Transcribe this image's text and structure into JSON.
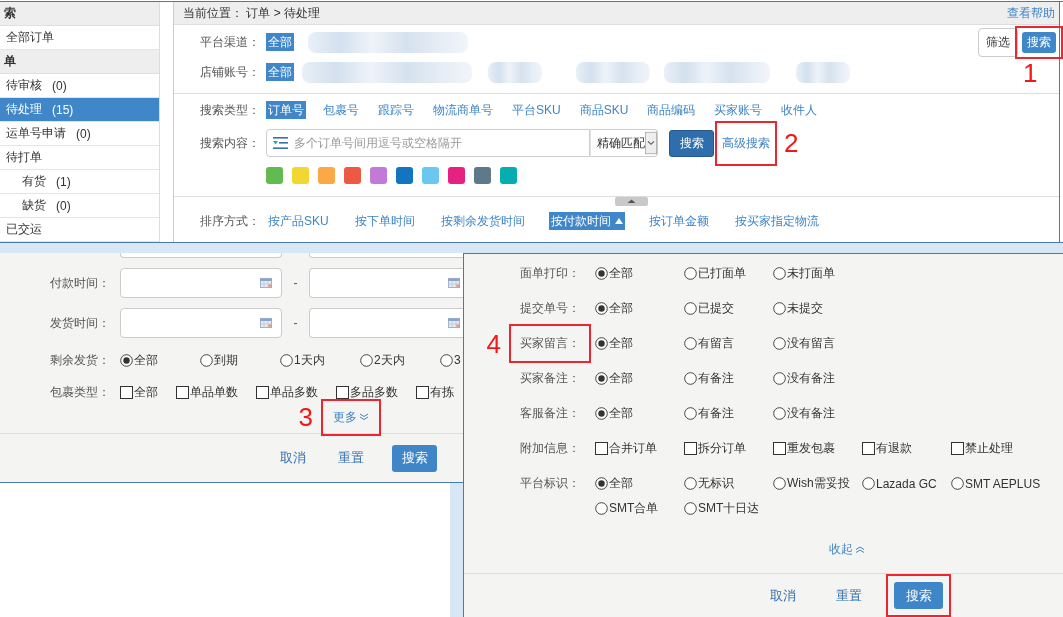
{
  "sidebar": {
    "groups": [
      {
        "title": "索",
        "items": [
          {
            "label": "全部订单",
            "selected": false
          }
        ]
      },
      {
        "title": "单",
        "items": [
          {
            "label": "待审核",
            "count": "(0)",
            "selected": false
          },
          {
            "label": "待处理",
            "count": "(15)",
            "selected": true
          },
          {
            "label": "运单号申请",
            "count": "(0)",
            "selected": false
          },
          {
            "label": "待打单",
            "selected": false,
            "children": [
              {
                "label": "有货",
                "count": "(1)",
                "selected": false
              },
              {
                "label": "缺货",
                "count": "(0)",
                "selected": false
              }
            ]
          },
          {
            "label": "已交运",
            "selected": false
          }
        ]
      }
    ]
  },
  "header": {
    "breadcrumb": "当前位置： 订单 > 待处理",
    "help_link": "查看帮助"
  },
  "filters": {
    "rows": [
      {
        "label": "平台渠道：",
        "options": [
          {
            "label": "全部",
            "selected": true
          }
        ],
        "redacted": true
      },
      {
        "label": "店铺账号：",
        "options": [
          {
            "label": "全部",
            "selected": true
          }
        ],
        "redacted": true
      }
    ],
    "buttons": [
      {
        "label": "筛选",
        "kind": "outline"
      },
      {
        "label": "搜索",
        "kind": "primary",
        "highlighted": true,
        "callout": "1"
      }
    ]
  },
  "search": {
    "type_label": "搜索类型：",
    "types": [
      {
        "label": "订单号",
        "selected": true
      },
      {
        "label": "包裹号",
        "selected": false
      },
      {
        "label": "跟踪号",
        "selected": false
      },
      {
        "label": "物流商单号",
        "selected": false
      },
      {
        "label": "平台SKU",
        "selected": false
      },
      {
        "label": "商品SKU",
        "selected": false
      },
      {
        "label": "商品编码",
        "selected": false
      },
      {
        "label": "买家账号",
        "selected": false
      },
      {
        "label": "收件人",
        "selected": false
      }
    ],
    "content_label": "搜索内容：",
    "placeholder": "多个订单号间用逗号或空格隔开",
    "match": "精确匹配",
    "button": "搜索",
    "advanced_link": {
      "label": "高级搜索",
      "highlighted": true,
      "callout": "2"
    },
    "color_tags": [
      {
        "color": "#62bb4f"
      },
      {
        "color": "#f2d730"
      },
      {
        "color": "#fca847"
      },
      {
        "color": "#ee5944"
      },
      {
        "color": "#c27ad8"
      },
      {
        "color": "#1375bf"
      },
      {
        "color": "#6ac7ef"
      },
      {
        "color": "#e52181"
      },
      {
        "color": "#5e7989"
      },
      {
        "color": "#04adb0"
      }
    ]
  },
  "sort": {
    "label": "排序方式：",
    "ascending": true,
    "options": [
      {
        "label": "按产品SKU",
        "selected": false
      },
      {
        "label": "按下单时间",
        "selected": false
      },
      {
        "label": "按剩余发货时间",
        "selected": false
      },
      {
        "label": "按付款时间",
        "selected": true
      },
      {
        "label": "按订单金额",
        "selected": false
      },
      {
        "label": "按买家指定物流",
        "selected": false
      }
    ]
  },
  "advanced_panel_left": {
    "rows": [
      {
        "kind": "stub"
      },
      {
        "kind": "date_range",
        "label": "付款时间：",
        "separator": "-"
      },
      {
        "kind": "date_range",
        "label": "发货时间：",
        "separator": "-"
      },
      {
        "kind": "radio",
        "label": "剩余发货：",
        "options": [
          {
            "label": "全部",
            "selected": true
          },
          {
            "label": "到期",
            "selected": false
          },
          {
            "label": "1天内",
            "selected": false
          },
          {
            "label": "2天内",
            "selected": false
          },
          {
            "label": "3",
            "selected": false
          }
        ]
      },
      {
        "kind": "checkbox",
        "label": "包裹类型：",
        "options": [
          {
            "label": "全部",
            "checked": false
          },
          {
            "label": "单品单数",
            "checked": false
          },
          {
            "label": "单品多数",
            "checked": false
          },
          {
            "label": "多品多数",
            "checked": false
          },
          {
            "label": "有拣",
            "checked": false
          }
        ]
      }
    ],
    "toggle_link": {
      "label": "更多",
      "expanded": false,
      "highlighted": true,
      "callout": "3"
    },
    "footer": [
      {
        "label": "取消",
        "kind": "link"
      },
      {
        "label": "重置",
        "kind": "link"
      },
      {
        "label": "搜索",
        "kind": "primary"
      }
    ]
  },
  "advanced_panel_right": {
    "rows": [
      {
        "kind": "radio",
        "label": "面单打印：",
        "options": [
          {
            "label": "全部",
            "selected": true
          },
          {
            "label": "已打面单",
            "selected": false
          },
          {
            "label": "未打面单",
            "selected": false
          }
        ]
      },
      {
        "kind": "radio",
        "label": "提交单号：",
        "options": [
          {
            "label": "全部",
            "selected": true
          },
          {
            "label": "已提交",
            "selected": false
          },
          {
            "label": "未提交",
            "selected": false
          }
        ]
      },
      {
        "kind": "radio",
        "label": "买家留言：",
        "highlighted": true,
        "callout": "4",
        "options": [
          {
            "label": "全部",
            "selected": true
          },
          {
            "label": "有留言",
            "selected": false
          },
          {
            "label": "没有留言",
            "selected": false
          }
        ]
      },
      {
        "kind": "radio",
        "label": "买家备注：",
        "options": [
          {
            "label": "全部",
            "selected": true
          },
          {
            "label": "有备注",
            "selected": false
          },
          {
            "label": "没有备注",
            "selected": false
          }
        ]
      },
      {
        "kind": "radio",
        "label": "客服备注：",
        "options": [
          {
            "label": "全部",
            "selected": true
          },
          {
            "label": "有备注",
            "selected": false
          },
          {
            "label": "没有备注",
            "selected": false
          }
        ]
      },
      {
        "kind": "checkbox",
        "label": "附加信息：",
        "options": [
          {
            "label": "合并订单",
            "checked": false
          },
          {
            "label": "拆分订单",
            "checked": false
          },
          {
            "label": "重发包裹",
            "checked": false
          },
          {
            "label": "有退款",
            "checked": false
          },
          {
            "label": "禁止处理",
            "checked": false
          }
        ]
      },
      {
        "kind": "radio",
        "label": "平台标识：",
        "options": [
          {
            "label": "全部",
            "selected": true
          },
          {
            "label": "无标识",
            "selected": false
          },
          {
            "label": "Wish需妥投",
            "selected": false
          },
          {
            "label": "Lazada GC",
            "selected": false
          },
          {
            "label": "SMT AEPLUS",
            "selected": false
          },
          {
            "label": "SMT合单",
            "selected": false
          },
          {
            "label": "SMT十日达",
            "selected": false
          }
        ]
      }
    ],
    "toggle_link": {
      "label": "收起",
      "expanded": true
    },
    "footer": [
      {
        "label": "取消",
        "kind": "link"
      },
      {
        "label": "重置",
        "kind": "link"
      },
      {
        "label": "搜索",
        "kind": "primary",
        "highlighted": true
      }
    ]
  }
}
